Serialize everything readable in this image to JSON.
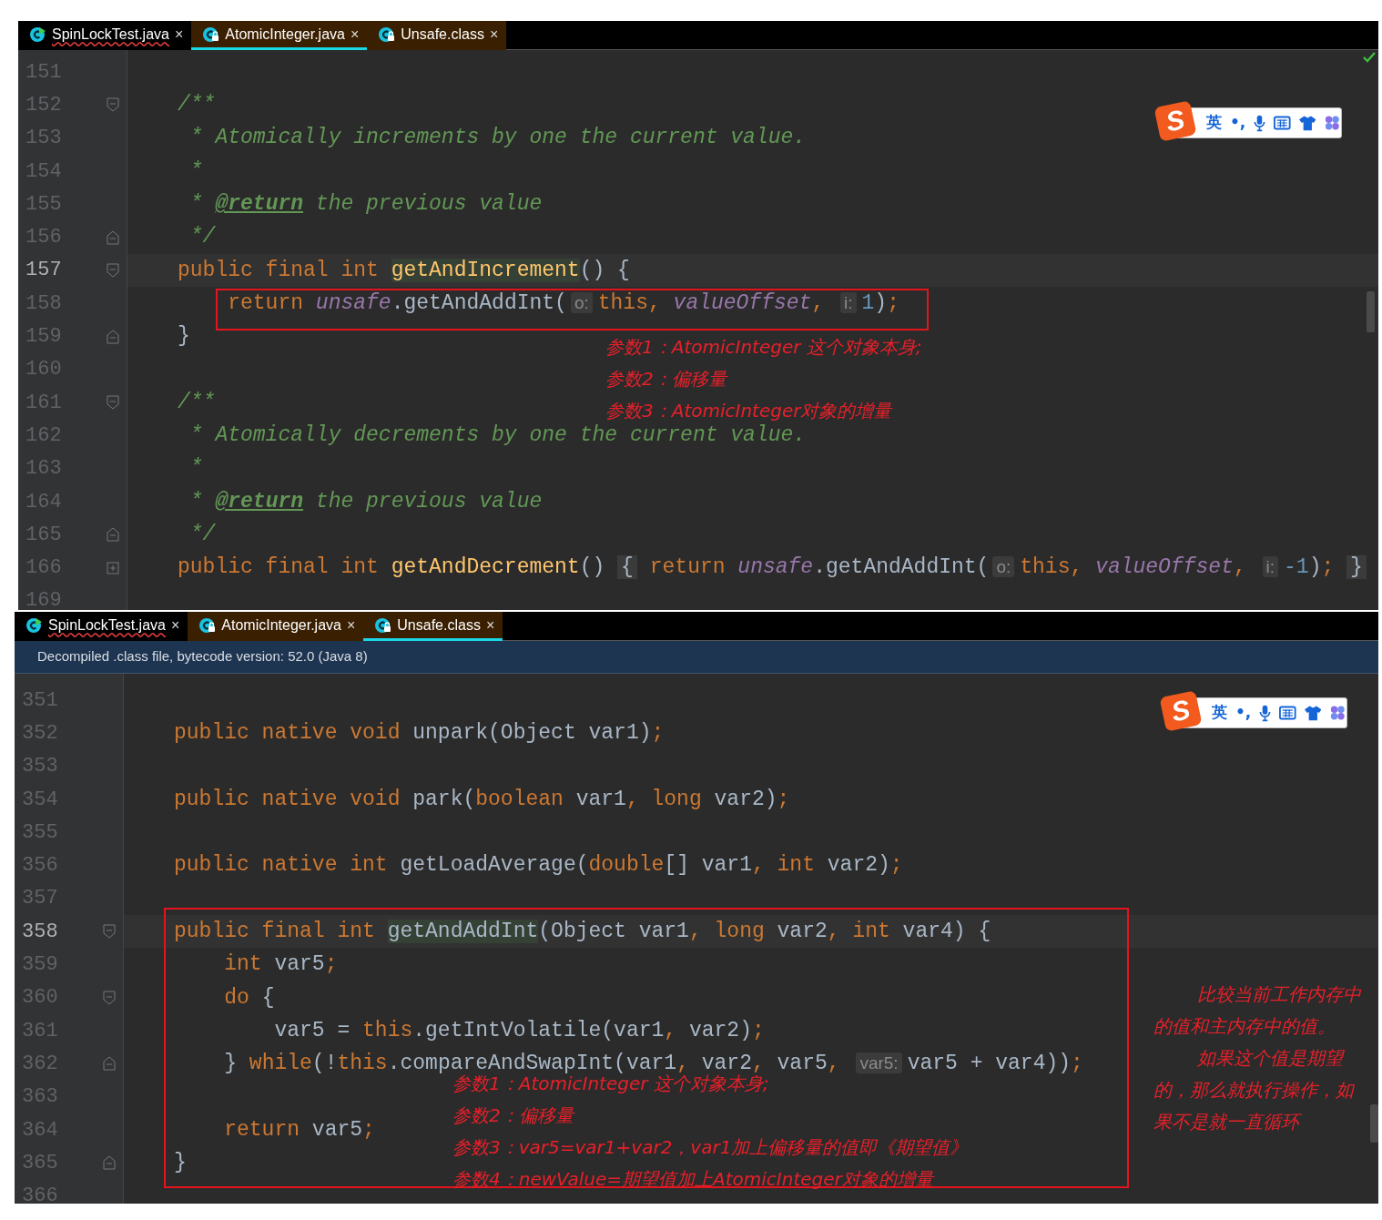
{
  "panes": [
    {
      "tabs": [
        {
          "label": "SpinLockTest.java",
          "close": "×",
          "selected": false,
          "readonly": false,
          "error": true
        },
        {
          "label": "AtomicInteger.java",
          "close": "×",
          "selected": true,
          "readonly": true,
          "error": false
        },
        {
          "label": "Unsafe.class",
          "close": "×",
          "selected": false,
          "readonly": true,
          "error": false
        }
      ],
      "ime": {
        "logo": "S",
        "lang": "英",
        "punct": "•,"
      },
      "lines": [
        {
          "number": "151",
          "current": false,
          "kind": "plain"
        },
        {
          "number": "152",
          "current": false,
          "kind": "opener",
          "tokens": [
            {
              "kind": "comment",
              "t": "/**"
            }
          ]
        },
        {
          "number": "153",
          "current": false,
          "kind": "plain",
          "tokens": [
            {
              "kind": "comment",
              "t": " * Atomically increments by one the current value."
            }
          ]
        },
        {
          "number": "154",
          "current": false,
          "kind": "plain",
          "tokens": [
            {
              "kind": "comment",
              "t": " *"
            }
          ]
        },
        {
          "number": "155",
          "current": false,
          "kind": "plain",
          "tokens": [
            {
              "kind": "comment",
              "t": " * "
            },
            {
              "kind": "tag",
              "t": "@return"
            },
            {
              "kind": "comment",
              "t": " the previous value"
            }
          ]
        },
        {
          "number": "156",
          "current": false,
          "kind": "closer",
          "tokens": [
            {
              "kind": "comment",
              "t": " */"
            }
          ]
        },
        {
          "number": "157",
          "current": true,
          "kind": "opener",
          "tokens": [
            {
              "kind": "keyword",
              "t": "public final int "
            },
            {
              "kind": "declhl",
              "t": "getAndIncrement"
            },
            {
              "kind": "plain",
              "t": "() {"
            }
          ]
        },
        {
          "number": "158",
          "current": false,
          "kind": "plain",
          "tokens": [
            {
              "kind": "keyword",
              "t": "    return "
            },
            {
              "kind": "field",
              "t": "unsafe"
            },
            {
              "kind": "plain",
              "t": ".getAndAddInt("
            },
            {
              "kind": "hint",
              "t": "o:"
            },
            {
              "kind": "keyword",
              "t": "this, "
            },
            {
              "kind": "field",
              "t": "valueOffset"
            },
            {
              "kind": "keyword",
              "t": ", "
            },
            {
              "kind": "hint",
              "t": "i:"
            },
            {
              "kind": "number",
              "t": "1"
            },
            {
              "kind": "plain",
              "t": ")"
            },
            {
              "kind": "keyword",
              "t": ";"
            }
          ]
        },
        {
          "number": "159",
          "current": false,
          "kind": "closer",
          "tokens": [
            {
              "kind": "plain",
              "t": "}"
            }
          ]
        },
        {
          "number": "160",
          "current": false,
          "kind": "plain"
        },
        {
          "number": "161",
          "current": false,
          "kind": "opener",
          "tokens": [
            {
              "kind": "comment",
              "t": "/**"
            }
          ]
        },
        {
          "number": "162",
          "current": false,
          "kind": "plain",
          "tokens": [
            {
              "kind": "comment",
              "t": " * Atomically decrements by one the current value."
            }
          ]
        },
        {
          "number": "163",
          "current": false,
          "kind": "plain",
          "tokens": [
            {
              "kind": "comment",
              "t": " *"
            }
          ]
        },
        {
          "number": "164",
          "current": false,
          "kind": "plain",
          "tokens": [
            {
              "kind": "comment",
              "t": " * "
            },
            {
              "kind": "tag",
              "t": "@return"
            },
            {
              "kind": "comment",
              "t": " the previous value"
            }
          ]
        },
        {
          "number": "165",
          "current": false,
          "kind": "closer",
          "tokens": [
            {
              "kind": "comment",
              "t": " */"
            }
          ]
        },
        {
          "number": "166",
          "current": false,
          "kind": "collapsed",
          "tokens": [
            {
              "kind": "keyword",
              "t": "public final int "
            },
            {
              "kind": "decl",
              "t": "getAndDecrement"
            },
            {
              "kind": "plain",
              "t": "() "
            },
            {
              "kind": "fold",
              "t": "{"
            },
            {
              "kind": "keyword",
              "t": " return "
            },
            {
              "kind": "field",
              "t": "unsafe"
            },
            {
              "kind": "plain",
              "t": ".getAndAddInt("
            },
            {
              "kind": "hint",
              "t": "o:"
            },
            {
              "kind": "keyword",
              "t": "this, "
            },
            {
              "kind": "field",
              "t": "valueOffset"
            },
            {
              "kind": "keyword",
              "t": ", "
            },
            {
              "kind": "hint",
              "t": "i:"
            },
            {
              "kind": "number",
              "t": "-1"
            },
            {
              "kind": "plain",
              "t": ")"
            },
            {
              "kind": "keyword",
              "t": "; "
            },
            {
              "kind": "fold",
              "t": "}"
            }
          ]
        },
        {
          "number": "169",
          "current": false,
          "kind": "plain"
        }
      ],
      "notes": [
        {
          "kind": "list",
          "lines": [
            "参数1：AtomicInteger 这个对象本身;",
            "参数2：偏移量",
            "参数3：AtomicInteger对象的增量"
          ]
        }
      ]
    },
    {
      "tabs": [
        {
          "label": "SpinLockTest.java",
          "close": "×",
          "selected": false,
          "readonly": false,
          "error": true
        },
        {
          "label": "AtomicInteger.java",
          "close": "×",
          "selected": false,
          "readonly": true,
          "error": false
        },
        {
          "label": "Unsafe.class",
          "close": "×",
          "selected": true,
          "readonly": true,
          "error": false
        }
      ],
      "banner": "Decompiled .class file, bytecode version: 52.0 (Java 8)",
      "ime": {
        "logo": "S",
        "lang": "英",
        "punct": "•,"
      },
      "lines": [
        {
          "number": "351",
          "current": false,
          "kind": "plain"
        },
        {
          "number": "352",
          "current": false,
          "kind": "plain",
          "tokens": [
            {
              "kind": "keyword",
              "t": "public native void "
            },
            {
              "kind": "plain",
              "t": "unpark(Object var1)"
            },
            {
              "kind": "keyword",
              "t": ";"
            }
          ]
        },
        {
          "number": "353",
          "current": false,
          "kind": "plain"
        },
        {
          "number": "354",
          "current": false,
          "kind": "plain",
          "tokens": [
            {
              "kind": "keyword",
              "t": "public native void "
            },
            {
              "kind": "plain",
              "t": "park("
            },
            {
              "kind": "keyword",
              "t": "boolean "
            },
            {
              "kind": "plain",
              "t": "var1"
            },
            {
              "kind": "keyword",
              "t": ", long "
            },
            {
              "kind": "plain",
              "t": "var2)"
            },
            {
              "kind": "keyword",
              "t": ";"
            }
          ]
        },
        {
          "number": "355",
          "current": false,
          "kind": "plain"
        },
        {
          "number": "356",
          "current": false,
          "kind": "plain",
          "tokens": [
            {
              "kind": "keyword",
              "t": "public native int "
            },
            {
              "kind": "plain",
              "t": "getLoadAverage("
            },
            {
              "kind": "keyword",
              "t": "double"
            },
            {
              "kind": "plain",
              "t": "[] var1"
            },
            {
              "kind": "keyword",
              "t": ", int "
            },
            {
              "kind": "plain",
              "t": "var2)"
            },
            {
              "kind": "keyword",
              "t": ";"
            }
          ]
        },
        {
          "number": "357",
          "current": false,
          "kind": "plain"
        },
        {
          "number": "358",
          "current": true,
          "kind": "opener",
          "tokens": [
            {
              "kind": "keyword",
              "t": "public final int "
            },
            {
              "kind": "namehl",
              "t": "getAndAddInt"
            },
            {
              "kind": "plain",
              "t": "(Object var1"
            },
            {
              "kind": "keyword",
              "t": ", long "
            },
            {
              "kind": "plain",
              "t": "var2"
            },
            {
              "kind": "keyword",
              "t": ", int "
            },
            {
              "kind": "plain",
              "t": "var4) {"
            }
          ]
        },
        {
          "number": "359",
          "current": false,
          "kind": "plain",
          "tokens": [
            {
              "kind": "keyword",
              "t": "    int "
            },
            {
              "kind": "plain",
              "t": "var5"
            },
            {
              "kind": "keyword",
              "t": ";"
            }
          ]
        },
        {
          "number": "360",
          "current": false,
          "kind": "opener",
          "tokens": [
            {
              "kind": "keyword",
              "t": "    do "
            },
            {
              "kind": "plain",
              "t": "{"
            }
          ]
        },
        {
          "number": "361",
          "current": false,
          "kind": "plain",
          "tokens": [
            {
              "kind": "plain",
              "t": "        var5 = "
            },
            {
              "kind": "keyword",
              "t": "this"
            },
            {
              "kind": "plain",
              "t": ".getIntVolatile(var1"
            },
            {
              "kind": "keyword",
              "t": ", "
            },
            {
              "kind": "plain",
              "t": "var2)"
            },
            {
              "kind": "keyword",
              "t": ";"
            }
          ]
        },
        {
          "number": "362",
          "current": false,
          "kind": "closer",
          "tokens": [
            {
              "kind": "plain",
              "t": "    } "
            },
            {
              "kind": "keyword",
              "t": "while"
            },
            {
              "kind": "plain",
              "t": "(!"
            },
            {
              "kind": "keyword",
              "t": "this"
            },
            {
              "kind": "plain",
              "t": ".compareAndSwapInt(var1"
            },
            {
              "kind": "keyword",
              "t": ", "
            },
            {
              "kind": "plain",
              "t": "var2"
            },
            {
              "kind": "keyword",
              "t": ", "
            },
            {
              "kind": "plain",
              "t": "var5"
            },
            {
              "kind": "keyword",
              "t": ", "
            },
            {
              "kind": "hint",
              "t": "var5:"
            },
            {
              "kind": "plain",
              "t": "var5 + var4))"
            },
            {
              "kind": "keyword",
              "t": ";"
            }
          ]
        },
        {
          "number": "363",
          "current": false,
          "kind": "plain"
        },
        {
          "number": "364",
          "current": false,
          "kind": "plain",
          "tokens": [
            {
              "kind": "keyword",
              "t": "    return "
            },
            {
              "kind": "plain",
              "t": "var5"
            },
            {
              "kind": "keyword",
              "t": ";"
            }
          ]
        },
        {
          "number": "365",
          "current": false,
          "kind": "closer",
          "tokens": [
            {
              "kind": "plain",
              "t": "}"
            }
          ]
        },
        {
          "number": "366",
          "current": false,
          "kind": "plain"
        }
      ],
      "notes": [
        {
          "kind": "list",
          "lines": [
            "参数1：AtomicInteger 这个对象本身;",
            "参数2：偏移量",
            "参数3：var5=var1+var2，var1加上偏移量的值即《期望值》",
            "参数4：newValue=期望值加上AtomicInteger对象的增量"
          ]
        },
        {
          "kind": "paragraphs",
          "lines": [
            "比较当前工作内存中的值和主内存中的值。",
            "如果这个值是期望的，那么就执行操作，如果不是就一直循环"
          ]
        }
      ]
    }
  ]
}
